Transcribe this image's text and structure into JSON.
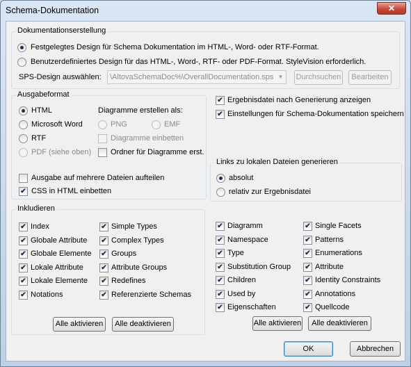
{
  "window": {
    "title": "Schema-Dokumentation",
    "close_glyph": "✕"
  },
  "doc_creation": {
    "legend": "Dokumentationserstellung",
    "option_fixed": "Festgelegtes Design für Schema Dokumentation im HTML-, Word- oder RTF-Format.",
    "option_custom": "Benutzerdefiniertes Design für das HTML-, Word-, RTF- oder PDF-Format. StyleVision erforderlich.",
    "sps_label": "SPS-Design auswählen:",
    "sps_value": "\\AltovaSchemaDoc%\\OverallDocumentation.sps",
    "browse_label": "Durchsuchen",
    "edit_label": "Bearbeiten"
  },
  "output_format": {
    "legend": "Ausgabeformat",
    "html": "HTML",
    "word": "Microsoft Word",
    "rtf": "RTF",
    "pdf": "PDF (siehe oben)",
    "diagrams_title": "Diagramme erstellen als:",
    "png": "PNG",
    "emf": "EMF",
    "embed_diagrams": "Diagramme einbetten",
    "diagram_folder": "Ordner für Diagramme erst.",
    "split_files": "Ausgabe auf mehrere Dateien aufteilen",
    "embed_css": "CSS in HTML einbetten"
  },
  "options": {
    "show_result": "Ergebnisdatei nach Generierung anzeigen",
    "save_settings": "Einstellungen für Schema-Dokumentation speichern"
  },
  "links": {
    "legend": "Links zu lokalen Dateien generieren",
    "absolute": "absolut",
    "relative": "relativ zur Ergebnisdatei"
  },
  "include": {
    "legend": "Inkludieren",
    "col1": [
      "Index",
      "Globale Attribute",
      "Globale Elemente",
      "Lokale Attribute",
      "Lokale Elemente",
      "Notations"
    ],
    "col2": [
      "Simple Types",
      "Complex Types",
      "Groups",
      "Attribute Groups",
      "Redefines",
      "Referenzierte Schemas"
    ],
    "activate_all": "Alle aktivieren",
    "deactivate_all": "Alle deaktivieren"
  },
  "details": {
    "col1": [
      "Diagramm",
      "Namespace",
      "Type",
      "Substitution Group",
      "Children",
      "Used by",
      "Eigenschaften"
    ],
    "col2": [
      "Single Facets",
      "Patterns",
      "Enumerations",
      "Attribute",
      "Identity Constraints",
      "Annotations",
      "Quellcode"
    ],
    "activate_all": "Alle aktivieren",
    "deactivate_all": "Alle deaktivieren"
  },
  "footer": {
    "ok": "OK",
    "cancel": "Abbrechen"
  },
  "check_glyph": "✔"
}
